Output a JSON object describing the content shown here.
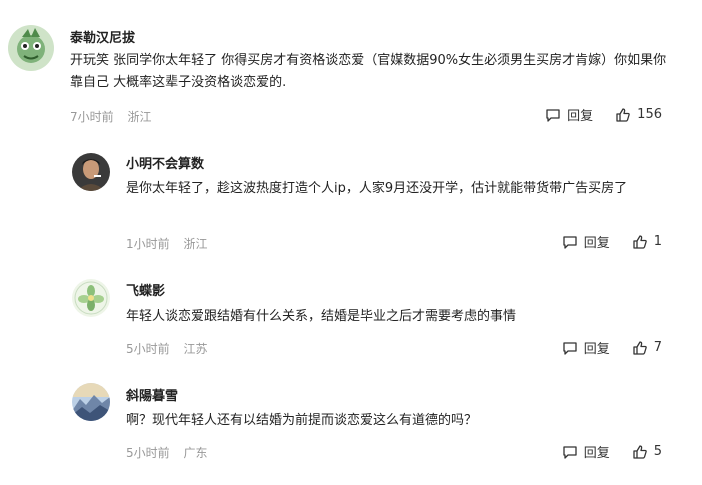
{
  "comments": [
    {
      "user": "泰勒汉尼拔",
      "text": "开玩笑 张同学你太年轻了 你得买房才有资格谈恋爱（官媒数据90%女生必须男生买房才肯嫁）你如果你靠自己 大概率这辈子没资格谈恋爱的.",
      "time": "7小时前",
      "location": "浙江",
      "reply_label": "回复",
      "likes": "156",
      "avatar_icon": "green-cartoon-avatar-icon"
    },
    {
      "user": "小明不会算数",
      "text": "是你太年轻了，趁这波热度打造个人ip，人家9月还没开学，估计就能带货带广告买房了",
      "time": "1小时前",
      "location": "浙江",
      "reply_label": "回复",
      "likes": "1",
      "avatar_icon": "man-portrait-avatar-icon"
    },
    {
      "user": "飞蝶影",
      "text": "年轻人谈恋爱跟结婚有什么关系，结婚是毕业之后才需要考虑的事情",
      "time": "5小时前",
      "location": "江苏",
      "reply_label": "回复",
      "likes": "7",
      "avatar_icon": "green-flower-avatar-icon"
    },
    {
      "user": "斜陽暮雪",
      "text": "啊？现代年轻人还有以结婚为前提而谈恋爱这么有道德的吗？",
      "time": "5小时前",
      "location": "广东",
      "reply_label": "回复",
      "likes": "5",
      "avatar_icon": "mountain-landscape-avatar-icon"
    }
  ],
  "colors": {
    "text": "#222222",
    "meta": "#999999",
    "background": "#ffffff"
  }
}
